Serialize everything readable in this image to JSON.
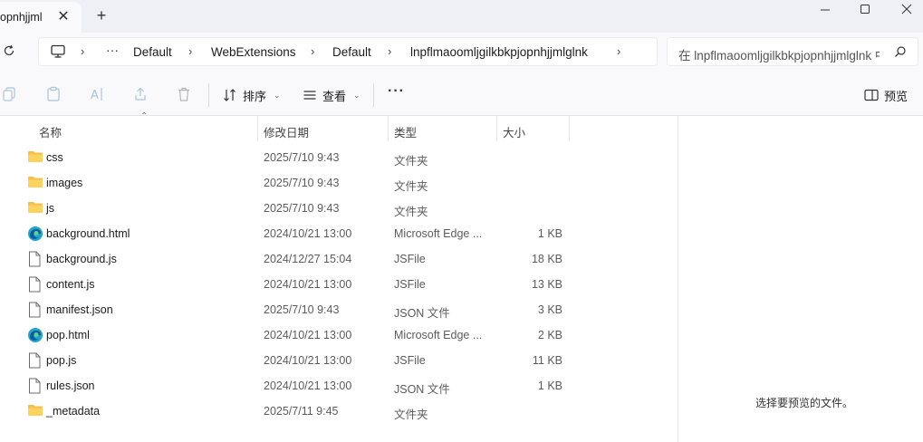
{
  "tab": {
    "title": "opnhjjml"
  },
  "breadcrumb": [
    "Default",
    "WebExtensions",
    "Default",
    "lnpflmaoomljgilkbkpjopnhjjmlglnk"
  ],
  "search": {
    "placeholder": "在 lnpflmaoomljgilkbkpjopnhjjmlglnk 中搜索"
  },
  "toolbar": {
    "sort_label": "排序",
    "view_label": "查看",
    "preview_label": "预览"
  },
  "columns": {
    "name": "名称",
    "date": "修改日期",
    "type": "类型",
    "size": "大小"
  },
  "files": [
    {
      "icon": "folder-icon",
      "name": "css",
      "date": "2025/7/10 9:43",
      "type": "文件夹",
      "size": ""
    },
    {
      "icon": "folder-icon",
      "name": "images",
      "date": "2025/7/10 9:43",
      "type": "文件夹",
      "size": ""
    },
    {
      "icon": "folder-icon",
      "name": "js",
      "date": "2025/7/10 9:43",
      "type": "文件夹",
      "size": ""
    },
    {
      "icon": "edge-icon",
      "name": "background.html",
      "date": "2024/10/21 13:00",
      "type": "Microsoft Edge ...",
      "size": "1 KB"
    },
    {
      "icon": "file-icon",
      "name": "background.js",
      "date": "2024/12/27 15:04",
      "type": "JSFile",
      "size": "18 KB"
    },
    {
      "icon": "file-icon",
      "name": "content.js",
      "date": "2024/10/21 13:00",
      "type": "JSFile",
      "size": "13 KB"
    },
    {
      "icon": "file-icon",
      "name": "manifest.json",
      "date": "2025/7/10 9:43",
      "type": "JSON 文件",
      "size": "3 KB"
    },
    {
      "icon": "edge-icon",
      "name": "pop.html",
      "date": "2024/10/21 13:00",
      "type": "Microsoft Edge ...",
      "size": "2 KB"
    },
    {
      "icon": "file-icon",
      "name": "pop.js",
      "date": "2024/10/21 13:00",
      "type": "JSFile",
      "size": "11 KB"
    },
    {
      "icon": "file-icon",
      "name": "rules.json",
      "date": "2024/10/21 13:00",
      "type": "JSON 文件",
      "size": "1 KB"
    },
    {
      "icon": "folder-icon",
      "name": "_metadata",
      "date": "2025/7/11 9:45",
      "type": "文件夹",
      "size": ""
    }
  ],
  "preview": {
    "message": "选择要预览的文件。"
  }
}
